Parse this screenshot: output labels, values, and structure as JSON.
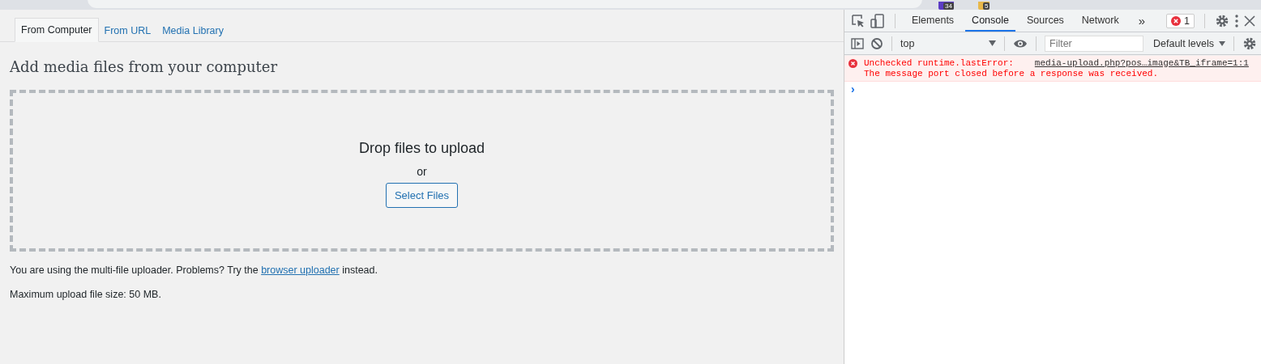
{
  "browser": {
    "extension_badges": [
      "34",
      "5"
    ]
  },
  "media_tabs": [
    {
      "label": "From Computer",
      "selected": true
    },
    {
      "label": "From URL",
      "selected": false
    },
    {
      "label": "Media Library",
      "selected": false
    }
  ],
  "heading": "Add media files from your computer",
  "drop_zone": {
    "title": "Drop files to upload",
    "or": "or",
    "button": "Select Files"
  },
  "uploader_note": {
    "before": "You are using the multi-file uploader. Problems? Try the ",
    "link": "browser uploader",
    "after": " instead."
  },
  "max_size": "Maximum upload file size: 50 MB.",
  "devtools": {
    "tabs": [
      {
        "label": "Elements",
        "selected": false
      },
      {
        "label": "Console",
        "selected": true
      },
      {
        "label": "Sources",
        "selected": false
      },
      {
        "label": "Network",
        "selected": false
      }
    ],
    "more": "»",
    "error_count": "1",
    "context": "top",
    "filter_placeholder": "Filter",
    "levels": "Default levels",
    "messages": [
      {
        "kind": "error",
        "text": "Unchecked runtime.lastError:",
        "source": "media-upload.php?pos…image&TB_iframe=1:1",
        "detail": "The message port closed before a response was received."
      }
    ],
    "prompt": "›"
  }
}
